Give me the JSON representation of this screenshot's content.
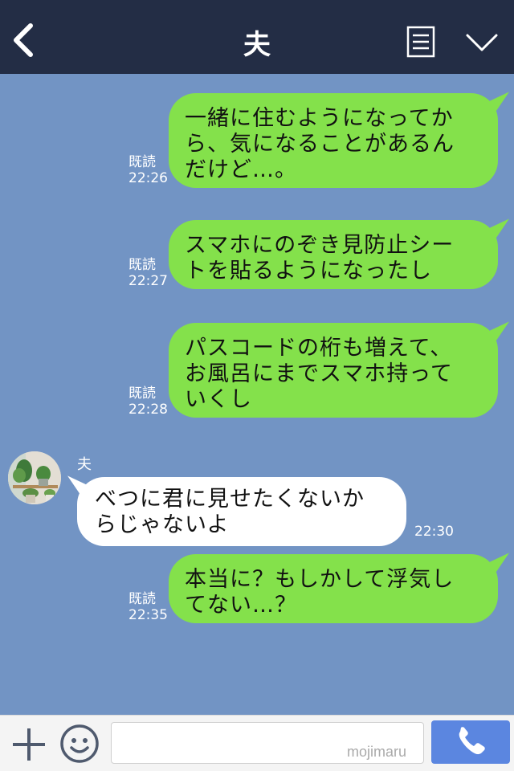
{
  "header": {
    "title": "夫",
    "back_icon": "chevron-left-icon",
    "note_icon": "note-icon",
    "expand_icon": "chevron-down-icon",
    "background": "#232d45"
  },
  "colors": {
    "chat_bg": "#7294c4",
    "outgoing_bubble": "#84e14b",
    "incoming_bubble": "#ffffff",
    "call_button": "#5b86e0"
  },
  "messages": [
    {
      "direction": "outgoing",
      "read_label": "既読",
      "time": "22:26",
      "lines": [
        "一緒に住むようになってか",
        "ら、気になることがあるん",
        "だけど…。"
      ]
    },
    {
      "direction": "outgoing",
      "read_label": "既読",
      "time": "22:27",
      "lines": [
        "スマホにのぞき見防止シー",
        "トを貼るようになったし"
      ]
    },
    {
      "direction": "outgoing",
      "read_label": "既読",
      "time": "22:28",
      "lines": [
        "パスコードの桁も増えて、",
        "お風呂にまでスマホ持って",
        "いくし"
      ]
    },
    {
      "direction": "incoming",
      "sender": "夫",
      "time": "22:30",
      "lines": [
        "べつに君に見せたくないか",
        "らじゃないよ"
      ]
    },
    {
      "direction": "outgoing",
      "read_label": "既読",
      "time": "22:35",
      "lines": [
        "本当に？もしかして浮気し",
        "てない…？"
      ]
    }
  ],
  "footer": {
    "plus_icon": "plus-icon",
    "emoji_icon": "smiley-icon",
    "input_value": "",
    "watermark": "mojimaru",
    "call_icon": "phone-icon"
  }
}
